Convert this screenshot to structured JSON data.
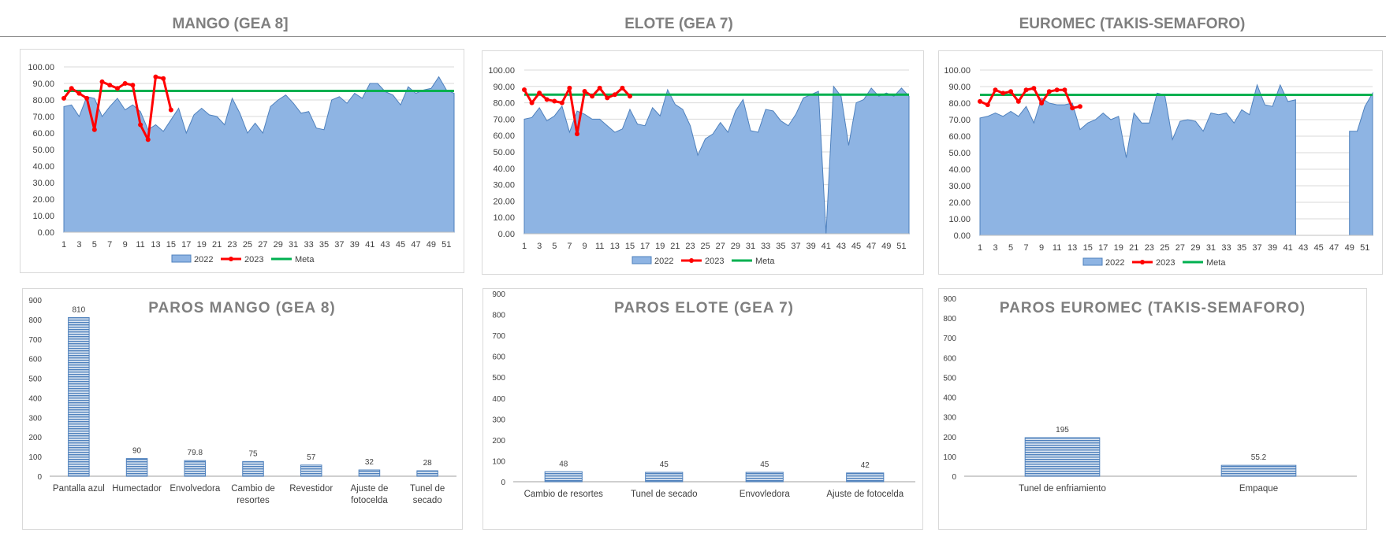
{
  "headers": [
    "MANGO (GEA 8]",
    "ELOTE (GEA 7)",
    "EUROMEC (TAKIS-SEMAFORO)"
  ],
  "colors": {
    "s2022_fill": "#8eb4e3",
    "s2022_line": "#4f81bd",
    "s2023": "#ff0000",
    "meta": "#00b050",
    "bar": "#4f81bd",
    "grid": "#d9d9d9",
    "text": "#404040"
  },
  "chart_data": [
    {
      "type": "area",
      "title": "",
      "x": [
        1,
        2,
        3,
        4,
        5,
        6,
        7,
        8,
        9,
        10,
        11,
        12,
        13,
        14,
        15,
        16,
        17,
        18,
        19,
        20,
        21,
        22,
        23,
        24,
        25,
        26,
        27,
        28,
        29,
        30,
        31,
        32,
        33,
        34,
        35,
        36,
        37,
        38,
        39,
        40,
        41,
        42,
        43,
        44,
        45,
        46,
        47,
        48,
        49,
        50,
        51,
        52
      ],
      "xticks": [
        "1",
        "3",
        "5",
        "7",
        "9",
        "11",
        "13",
        "15",
        "17",
        "19",
        "21",
        "23",
        "25",
        "27",
        "29",
        "31",
        "33",
        "35",
        "37",
        "39",
        "41",
        "43",
        "45",
        "47",
        "49",
        "51"
      ],
      "yticks": [
        "0.00",
        "10.00",
        "20.00",
        "30.00",
        "40.00",
        "50.00",
        "60.00",
        "70.00",
        "80.00",
        "90.00",
        "100.00"
      ],
      "ylim": [
        0,
        100
      ],
      "series": [
        {
          "name": "2022",
          "values": [
            76,
            77,
            70,
            82,
            81,
            70,
            76,
            81,
            74,
            77,
            73,
            62,
            65,
            61,
            68,
            75,
            60,
            71,
            75,
            71,
            70,
            65,
            81,
            72,
            60,
            66,
            60,
            76,
            80,
            83,
            78,
            72,
            73,
            63,
            62,
            80,
            82,
            78,
            84,
            81,
            90,
            90,
            85,
            83,
            77,
            88,
            84,
            86,
            87,
            94,
            86,
            84
          ]
        },
        {
          "name": "2023",
          "values": [
            81,
            87,
            84,
            81,
            62,
            91,
            89,
            87,
            90,
            89,
            65,
            56,
            94,
            93,
            74
          ]
        },
        {
          "name": "Meta",
          "values": [
            85.5
          ]
        }
      ]
    },
    {
      "type": "area",
      "title": "",
      "x": [
        1,
        2,
        3,
        4,
        5,
        6,
        7,
        8,
        9,
        10,
        11,
        12,
        13,
        14,
        15,
        16,
        17,
        18,
        19,
        20,
        21,
        22,
        23,
        24,
        25,
        26,
        27,
        28,
        29,
        30,
        31,
        32,
        33,
        34,
        35,
        36,
        37,
        38,
        39,
        40,
        41,
        42,
        43,
        44,
        45,
        46,
        47,
        48,
        49,
        50,
        51,
        52
      ],
      "xticks": [
        "1",
        "3",
        "5",
        "7",
        "9",
        "11",
        "13",
        "15",
        "17",
        "19",
        "21",
        "23",
        "25",
        "27",
        "29",
        "31",
        "33",
        "35",
        "37",
        "39",
        "41",
        "43",
        "45",
        "47",
        "49",
        "51"
      ],
      "yticks": [
        "0.00",
        "10.00",
        "20.00",
        "30.00",
        "40.00",
        "50.00",
        "60.00",
        "70.00",
        "80.00",
        "90.00",
        "100.00"
      ],
      "ylim": [
        0,
        100
      ],
      "series": [
        {
          "name": "2022",
          "values": [
            70,
            71,
            77,
            69,
            72,
            78,
            62,
            75,
            73,
            70,
            70,
            66,
            62,
            64,
            76,
            67,
            66,
            77,
            72,
            88,
            79,
            76,
            66,
            48,
            58,
            61,
            68,
            62,
            75,
            82,
            63,
            62,
            76,
            75,
            69,
            66,
            73,
            83,
            85,
            87,
            0,
            90,
            84,
            54,
            80,
            82,
            89,
            84,
            86,
            84,
            89,
            84
          ]
        },
        {
          "name": "2023",
          "values": [
            88,
            80,
            86,
            82,
            81,
            80,
            89,
            61,
            87,
            84,
            89,
            83,
            85,
            89,
            84
          ]
        },
        {
          "name": "Meta",
          "values": [
            85
          ]
        }
      ]
    },
    {
      "type": "area",
      "title": "",
      "x": [
        1,
        2,
        3,
        4,
        5,
        6,
        7,
        8,
        9,
        10,
        11,
        12,
        13,
        14,
        15,
        16,
        17,
        18,
        19,
        20,
        21,
        22,
        23,
        24,
        25,
        26,
        27,
        28,
        29,
        30,
        31,
        32,
        33,
        34,
        35,
        36,
        37,
        38,
        39,
        40,
        41,
        42,
        43,
        44,
        45,
        46,
        47,
        48,
        49,
        50,
        51,
        52
      ],
      "xticks": [
        "1",
        "3",
        "5",
        "7",
        "9",
        "11",
        "13",
        "15",
        "17",
        "19",
        "21",
        "23",
        "25",
        "27",
        "29",
        "31",
        "33",
        "35",
        "37",
        "39",
        "41",
        "43",
        "45",
        "47",
        "49",
        "51"
      ],
      "yticks": [
        "0.00",
        "10.00",
        "20.00",
        "30.00",
        "40.00",
        "50.00",
        "60.00",
        "70.00",
        "80.00",
        "90.00",
        "100.00"
      ],
      "ylim": [
        0,
        100
      ],
      "series": [
        {
          "name": "2022",
          "values": [
            71,
            72,
            74,
            72,
            75,
            72,
            78,
            68,
            83,
            80,
            79,
            79,
            80,
            64,
            68,
            70,
            74,
            70,
            72,
            47,
            74,
            68,
            68,
            86,
            85,
            58,
            69,
            70,
            69,
            63,
            74,
            73,
            74,
            68,
            76,
            73,
            91,
            79,
            78,
            91,
            81,
            82,
            null,
            null,
            null,
            null,
            null,
            null,
            63,
            63,
            78,
            86
          ]
        },
        {
          "name": "2023",
          "values": [
            81,
            79,
            88,
            86,
            87,
            81,
            88,
            89,
            80,
            87,
            88,
            88,
            77,
            78
          ]
        },
        {
          "name": "Meta",
          "values": [
            85
          ]
        }
      ]
    },
    {
      "type": "bar",
      "title": "PAROS MANGO (GEA 8)",
      "categories": [
        "Pantalla azul",
        "Humectador",
        "Envolvedora",
        "Cambio de resortes",
        "Revestidor",
        "Ajuste de fotocelda",
        "Tunel de secado"
      ],
      "cat_lines": [
        [
          "Pantalla azul"
        ],
        [
          "Humectador"
        ],
        [
          "Envolvedora"
        ],
        [
          "Cambio de",
          "resortes"
        ],
        [
          "Revestidor"
        ],
        [
          "Ajuste de",
          "fotocelda"
        ],
        [
          "Tunel de",
          "secado"
        ]
      ],
      "values": [
        810,
        90,
        79.8,
        75,
        57,
        32,
        28
      ],
      "labels": [
        "810",
        "90",
        "79.8",
        "75",
        "57",
        "32",
        "28"
      ],
      "yticks": [
        "0",
        "100",
        "200",
        "300",
        "400",
        "500",
        "600",
        "700",
        "800",
        "900"
      ],
      "ylim": [
        0,
        900
      ]
    },
    {
      "type": "bar",
      "title": "PAROS ELOTE (GEA 7)",
      "categories": [
        "Cambio de resortes",
        "Tunel de secado",
        "Envovledora",
        "Ajuste de fotocelda"
      ],
      "cat_lines": [
        [
          "Cambio de resortes"
        ],
        [
          "Tunel de secado"
        ],
        [
          "Envovledora"
        ],
        [
          "Ajuste de fotocelda"
        ]
      ],
      "values": [
        48,
        45,
        45,
        42
      ],
      "labels": [
        "48",
        "45",
        "45",
        "42"
      ],
      "yticks": [
        "0",
        "100",
        "200",
        "300",
        "400",
        "500",
        "600",
        "700",
        "800",
        "900"
      ],
      "ylim": [
        0,
        900
      ]
    },
    {
      "type": "bar",
      "title": "PAROS EUROMEC (TAKIS-SEMAFORO)",
      "categories": [
        "Tunel de enfriamiento",
        "Empaque"
      ],
      "cat_lines": [
        [
          "Tunel de enfriamiento"
        ],
        [
          "Empaque"
        ]
      ],
      "values": [
        195,
        55.2
      ],
      "labels": [
        "195",
        "55.2"
      ],
      "yticks": [
        "0",
        "100",
        "200",
        "300",
        "400",
        "500",
        "600",
        "700",
        "800",
        "900"
      ],
      "ylim": [
        0,
        900
      ]
    }
  ]
}
